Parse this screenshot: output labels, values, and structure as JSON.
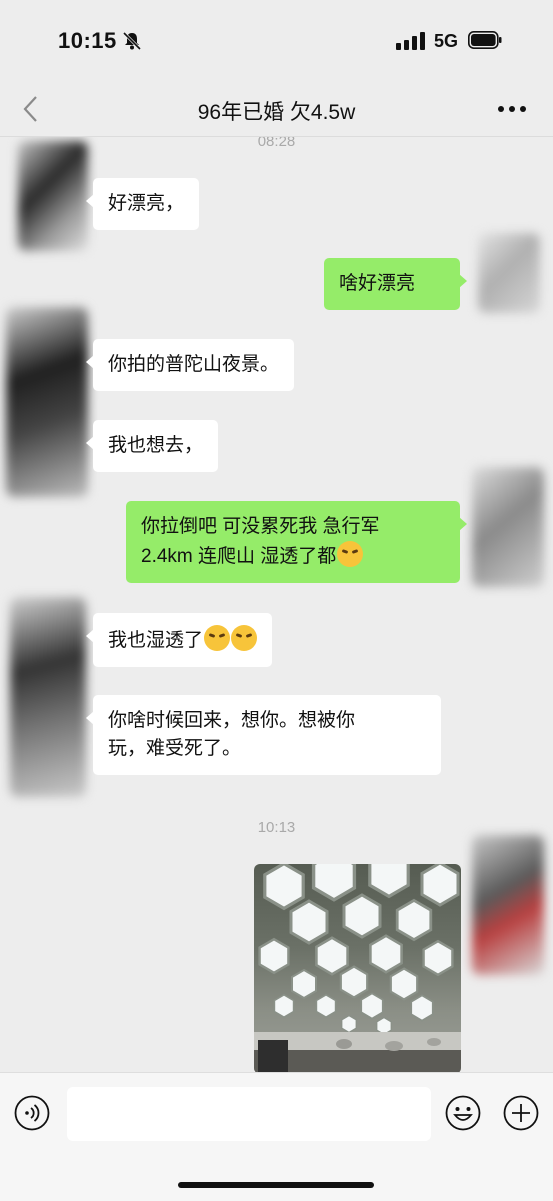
{
  "status_bar": {
    "time": "10:15",
    "network": "5G"
  },
  "header": {
    "title": "96年已婚 欠4.5w"
  },
  "messages": [
    {
      "timestamp": "08:28"
    },
    {
      "side": "in",
      "text": "好漂亮，"
    },
    {
      "side": "out",
      "text": "啥好漂亮"
    },
    {
      "side": "in",
      "text": "你拍的普陀山夜景。"
    },
    {
      "side": "in",
      "text": "我也想去，"
    },
    {
      "side": "out",
      "line1": "你拉倒吧 可没累死我 急行军",
      "line2": "2.4km 连爬山 湿透了都",
      "emoji": "persevering-face"
    },
    {
      "side": "in",
      "text": "我也湿透了",
      "emoji": "persevering-face"
    },
    {
      "side": "in",
      "line1": "你啥时候回来，想你。想被你",
      "line2": "玩，难受死了。"
    },
    {
      "timestamp": "10:13"
    },
    {
      "side": "out",
      "type": "image",
      "image_description": "photo of hexagonal ceiling lights"
    }
  ],
  "colors": {
    "background": "#ededed",
    "outgoing_bubble": "#95ec69",
    "incoming_bubble": "#ffffff"
  }
}
